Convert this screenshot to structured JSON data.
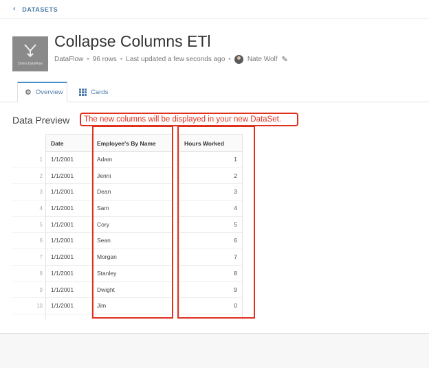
{
  "nav": {
    "back_label": "DATASETS"
  },
  "dataset": {
    "icon_caption": "Domo DataFlow",
    "title": "Collapse Columns ETl",
    "type": "DataFlow",
    "rows": "96 rows",
    "updated": "Last updated a few seconds ago",
    "owner": "Nate Wolf"
  },
  "tabs": [
    {
      "label": "Overview",
      "icon": "gear-icon",
      "active": true
    },
    {
      "label": "Cards",
      "icon": "grid-icon",
      "active": false
    }
  ],
  "preview": {
    "title": "Data Preview",
    "callout": "The new columns will be displayed in your new DataSet.",
    "highlight_color": "#e0301e"
  },
  "table": {
    "headers": [
      "Date",
      "Employee's By Name",
      "Hours Worked"
    ],
    "row_numbers": [
      "1",
      "2",
      "3",
      "4",
      "5",
      "6",
      "7",
      "8",
      "9",
      "10"
    ],
    "rows": [
      [
        "1/1/2001",
        "Adam",
        "1"
      ],
      [
        "1/1/2001",
        "Jenni",
        "2"
      ],
      [
        "1/1/2001",
        "Dean",
        "3"
      ],
      [
        "1/1/2001",
        "Sam",
        "4"
      ],
      [
        "1/1/2001",
        "Cory",
        "5"
      ],
      [
        "1/1/2001",
        "Sean",
        "6"
      ],
      [
        "1/1/2001",
        "Morgan",
        "7"
      ],
      [
        "1/1/2001",
        "Stanley",
        "8"
      ],
      [
        "1/1/2001",
        "Dwight",
        "9"
      ],
      [
        "1/1/2001",
        "Jim",
        "0"
      ]
    ]
  },
  "colors": {
    "accent": "#4a7ba8",
    "tab_active_border": "#4a90c8"
  }
}
